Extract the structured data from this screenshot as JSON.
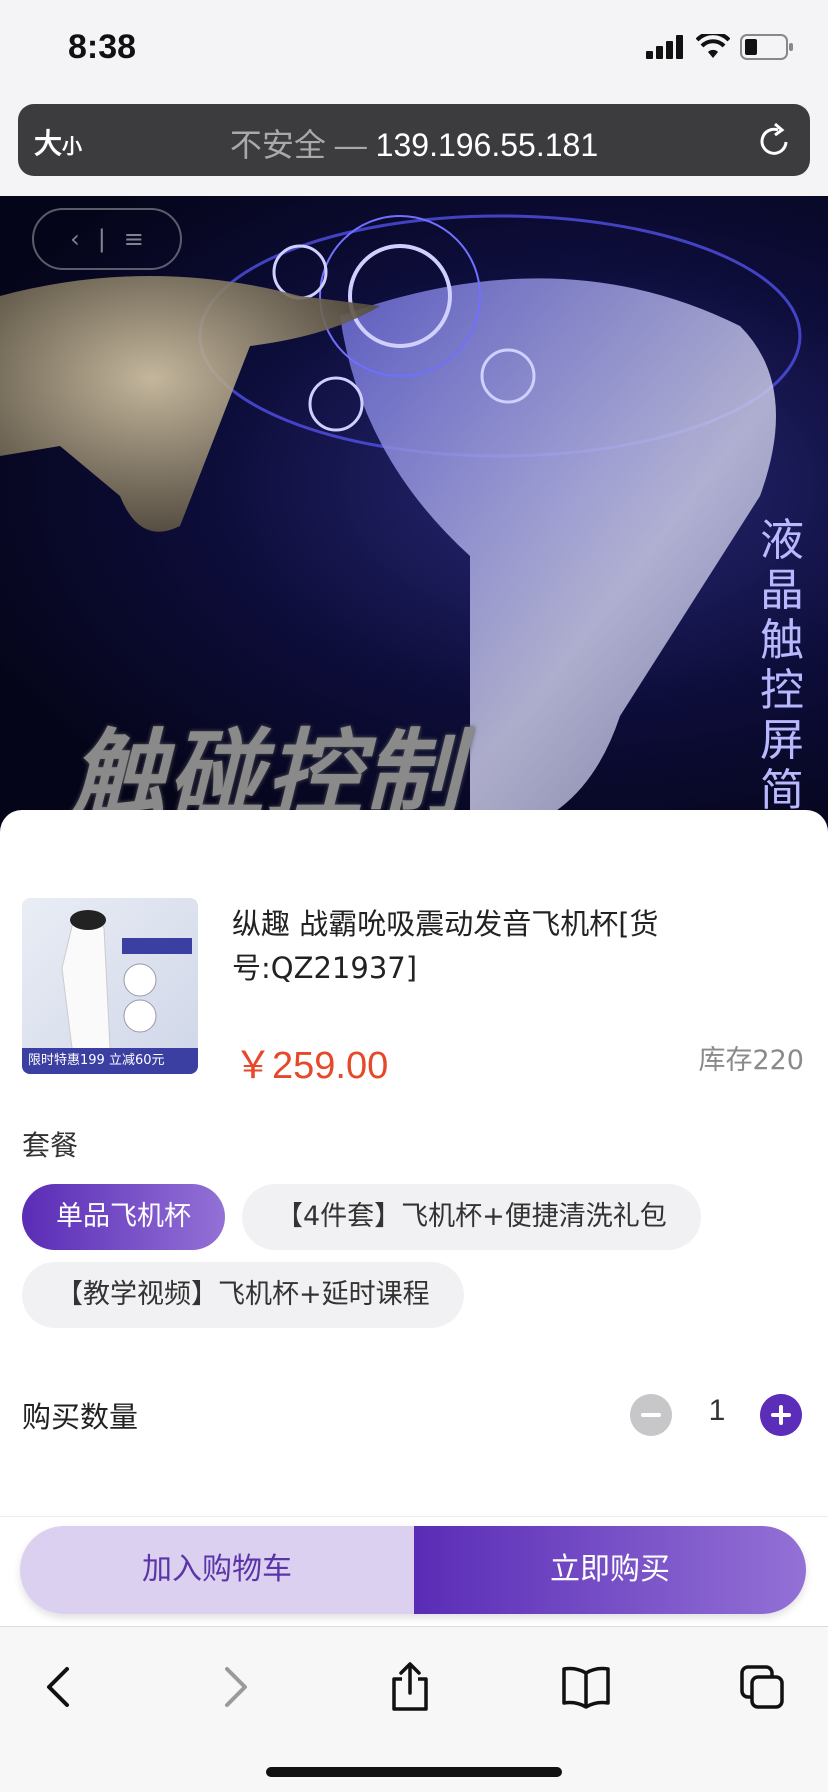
{
  "status_bar": {
    "time": "8:38"
  },
  "url_bar": {
    "text_size_label": "大",
    "text_size_small": "小",
    "insecure_label": "不安全 —",
    "host": "139.196.55.181"
  },
  "hero": {
    "title_text": "触碰控制",
    "vertical_text": "液晶触控屏简"
  },
  "product": {
    "name": "纵趣 战霸吮吸震动发音飞机杯[货号:QZ21937]",
    "price": "￥259.00",
    "stock": "库存220",
    "thumb_badge": "限时特惠199 立减60元"
  },
  "package": {
    "label": "套餐",
    "options": [
      "单品飞机杯",
      "【4件套】飞机杯+便捷清洗礼包",
      "【教学视频】飞机杯+延时课程"
    ],
    "selected": "单品飞机杯"
  },
  "quantity": {
    "label": "购买数量",
    "value": "1"
  },
  "actions": {
    "add_to_cart": "加入购物车",
    "buy_now": "立即购买"
  },
  "toolbar": {
    "icons": [
      "back-icon",
      "forward-icon",
      "share-icon",
      "bookmarks-icon",
      "tabs-icon"
    ]
  },
  "colors": {
    "accent": "#5b2db8",
    "price": "#e6482a"
  }
}
